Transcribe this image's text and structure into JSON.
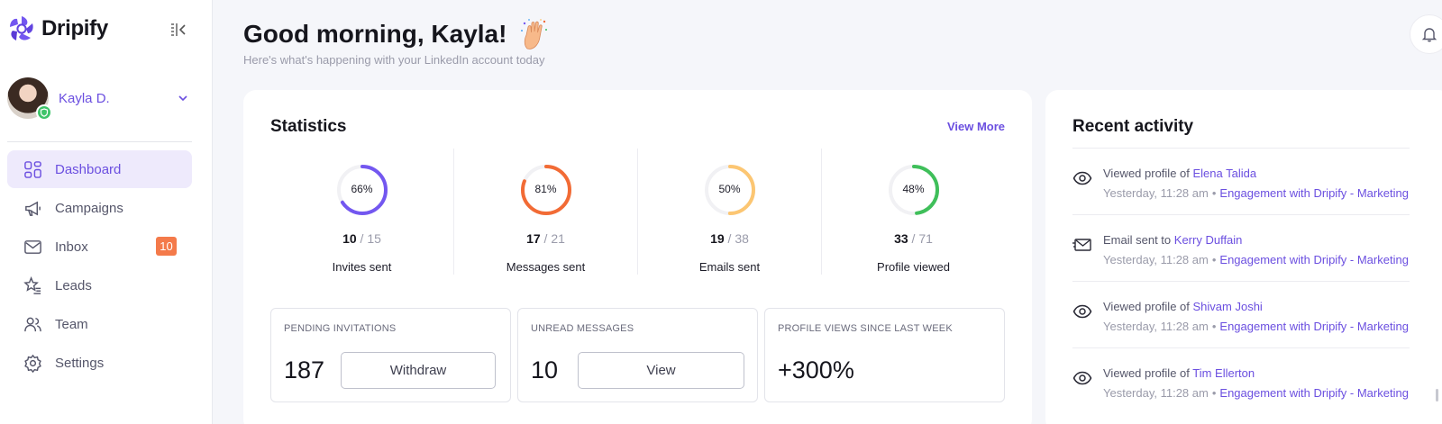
{
  "brand": {
    "name": "Dripify",
    "accent": "#6b4fe0"
  },
  "user": {
    "name": "Kayla D."
  },
  "nav": [
    {
      "label": "Dashboard",
      "icon": "grid-icon",
      "active": true
    },
    {
      "label": "Campaigns",
      "icon": "megaphone-icon",
      "active": false
    },
    {
      "label": "Inbox",
      "icon": "mail-icon",
      "active": false,
      "badge": "10"
    },
    {
      "label": "Leads",
      "icon": "star-list-icon",
      "active": false
    },
    {
      "label": "Team",
      "icon": "users-icon",
      "active": false
    },
    {
      "label": "Settings",
      "icon": "gear-icon",
      "active": false
    }
  ],
  "header": {
    "title": "Good morning, Kayla!",
    "subtitle": "Here's what's happening with your LinkedIn account today"
  },
  "statistics": {
    "title": "Statistics",
    "view_more": "View More",
    "metrics": [
      {
        "percent_label": "66%",
        "percent": 66,
        "value": "10",
        "total": "15",
        "label": "Invites sent",
        "color": "#7357f0"
      },
      {
        "percent_label": "81%",
        "percent": 81,
        "value": "17",
        "total": "21",
        "label": "Messages sent",
        "color": "#f26b35"
      },
      {
        "percent_label": "50%",
        "percent": 50,
        "value": "19",
        "total": "38",
        "label": "Emails sent",
        "color": "#fcc672"
      },
      {
        "percent_label": "48%",
        "percent": 48,
        "value": "33",
        "total": "71",
        "label": "Profile viewed",
        "color": "#3fbf5a"
      }
    ],
    "boxes": {
      "pending": {
        "title": "PENDING INVITATIONS",
        "value": "187",
        "button": "Withdraw"
      },
      "unread": {
        "title": "UNREAD MESSAGES",
        "value": "10",
        "button": "View"
      },
      "views": {
        "title": "PROFILE VIEWS SINCE LAST WEEK",
        "value": "+300%"
      }
    }
  },
  "activity": {
    "title": "Recent activity",
    "items": [
      {
        "icon": "eye-icon",
        "action": "Viewed profile of",
        "person": "Elena Talida",
        "time": "Yesterday, 11:28 am",
        "campaign": "Engagement with Dripify - Marketing"
      },
      {
        "icon": "email-sent-icon",
        "action": "Email sent to",
        "person": "Kerry Duffain",
        "time": "Yesterday, 11:28 am",
        "campaign": "Engagement with Dripify - Marketing"
      },
      {
        "icon": "eye-icon",
        "action": "Viewed profile of",
        "person": "Shivam Joshi",
        "time": "Yesterday, 11:28 am",
        "campaign": "Engagement with Dripify - Marketing"
      },
      {
        "icon": "eye-icon",
        "action": "Viewed profile of",
        "person": "Tim Ellerton",
        "time": "Yesterday, 11:28 am",
        "campaign": "Engagement with Dripify - Marketing"
      }
    ]
  }
}
